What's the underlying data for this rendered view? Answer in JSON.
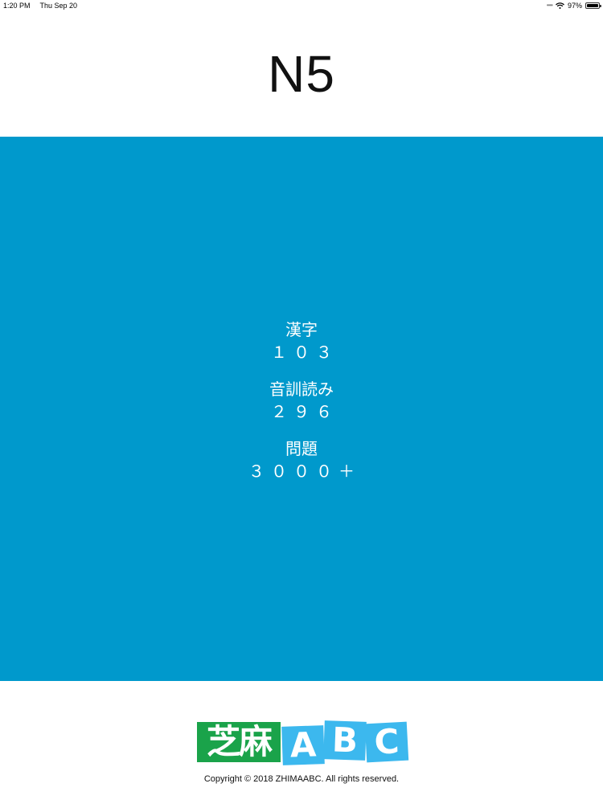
{
  "status_bar": {
    "time": "1:20 PM",
    "date": "Thu Sep 20",
    "battery_percent": "97%",
    "battery_level": 0.97,
    "icons": [
      "signal-icon",
      "wifi-icon",
      "battery-icon"
    ]
  },
  "header": {
    "title": "N5"
  },
  "colors": {
    "panel": "#0099cc",
    "logo_green": "#1aa34a",
    "logo_blue": "#3cb8ee"
  },
  "stats": [
    {
      "label": "漢字",
      "value": "１０３"
    },
    {
      "label": "音訓読み",
      "value": "２９６"
    },
    {
      "label": "問題",
      "value": "３０００＋"
    }
  ],
  "footer": {
    "logo": {
      "chinese": "芝麻",
      "letters": [
        "A",
        "B",
        "C"
      ]
    },
    "copyright": "Copyright © 2018 ZHIMAABC. All rights reserved."
  }
}
